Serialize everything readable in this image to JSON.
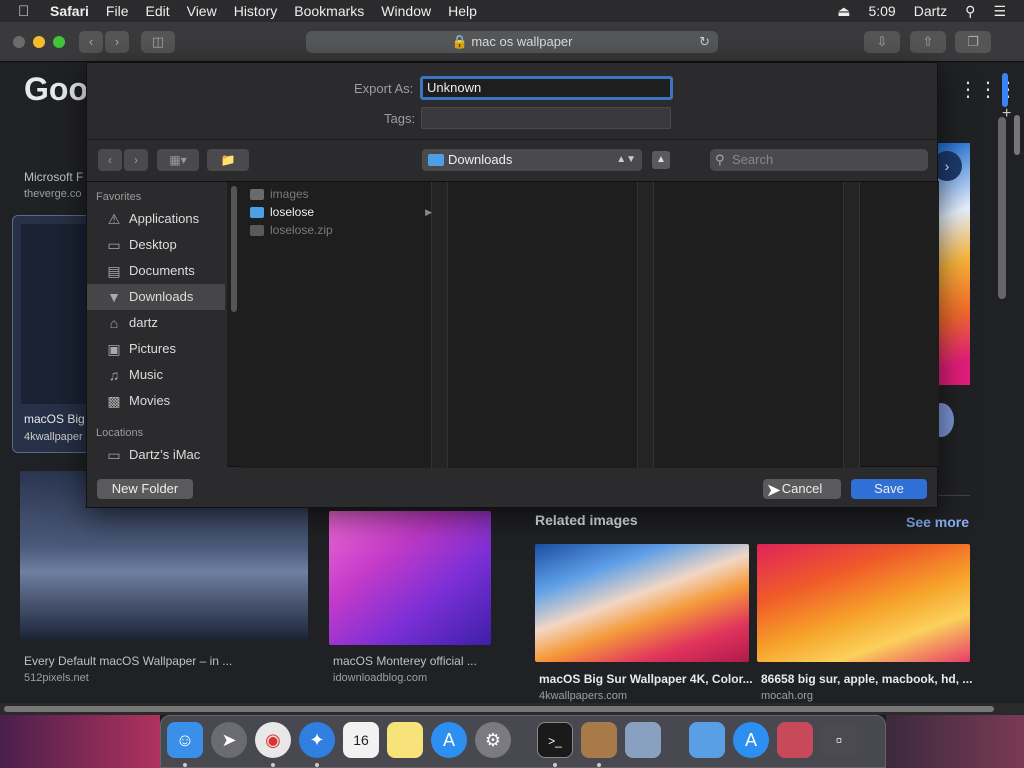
{
  "menubar": {
    "app": "Safari",
    "items": [
      "File",
      "Edit",
      "View",
      "History",
      "Bookmarks",
      "Window",
      "Help"
    ],
    "time": "5:09",
    "user": "Dartz"
  },
  "toolbar": {
    "url": "mac os wallpaper"
  },
  "page": {
    "logo": "Goog",
    "left_card_title": "Microsoft F",
    "left_card_source": "theverge.co",
    "left_card2_title": "macOS Big",
    "left_card2_source": "4kwallpaper",
    "results": [
      {
        "title": "Every Default macOS Wallpaper – in ...",
        "source": "512pixels.net"
      },
      {
        "title": "macOS Monterey official ...",
        "source": "idownloadblog.com"
      }
    ],
    "related_title": "Related images",
    "see_more": "See more",
    "related": [
      {
        "title": "macOS Big Sur Wallpaper 4K, Color...",
        "source": "4kwallpapers.com"
      },
      {
        "title": "86658 big sur, apple, macbook, hd, ...",
        "source": "mocah.org"
      }
    ]
  },
  "dialog": {
    "export_label": "Export As:",
    "export_value": "Unknown",
    "tags_label": "Tags:",
    "location": "Downloads",
    "search_placeholder": "Search",
    "favorites_header": "Favorites",
    "favorites": [
      {
        "label": "Applications",
        "icon": "applications-icon"
      },
      {
        "label": "Desktop",
        "icon": "desktop-icon"
      },
      {
        "label": "Documents",
        "icon": "documents-icon"
      },
      {
        "label": "Downloads",
        "icon": "downloads-icon",
        "selected": true
      },
      {
        "label": "dartz",
        "icon": "home-icon"
      },
      {
        "label": "Pictures",
        "icon": "pictures-icon"
      },
      {
        "label": "Music",
        "icon": "music-icon"
      },
      {
        "label": "Movies",
        "icon": "movies-icon"
      }
    ],
    "locations_header": "Locations",
    "locations": [
      {
        "label": "Dartz’s iMac",
        "icon": "imac-icon"
      }
    ],
    "files": [
      {
        "name": "images",
        "type": "file",
        "enabled": false
      },
      {
        "name": "loselose",
        "type": "folder",
        "enabled": true
      },
      {
        "name": "loselose.zip",
        "type": "file",
        "enabled": false
      }
    ],
    "new_folder": "New Folder",
    "cancel": "Cancel",
    "save": "Save"
  },
  "colors": {
    "accent": "#2f6fd6",
    "folder": "#4ea0e6",
    "see_more": "#8ab4f8"
  }
}
